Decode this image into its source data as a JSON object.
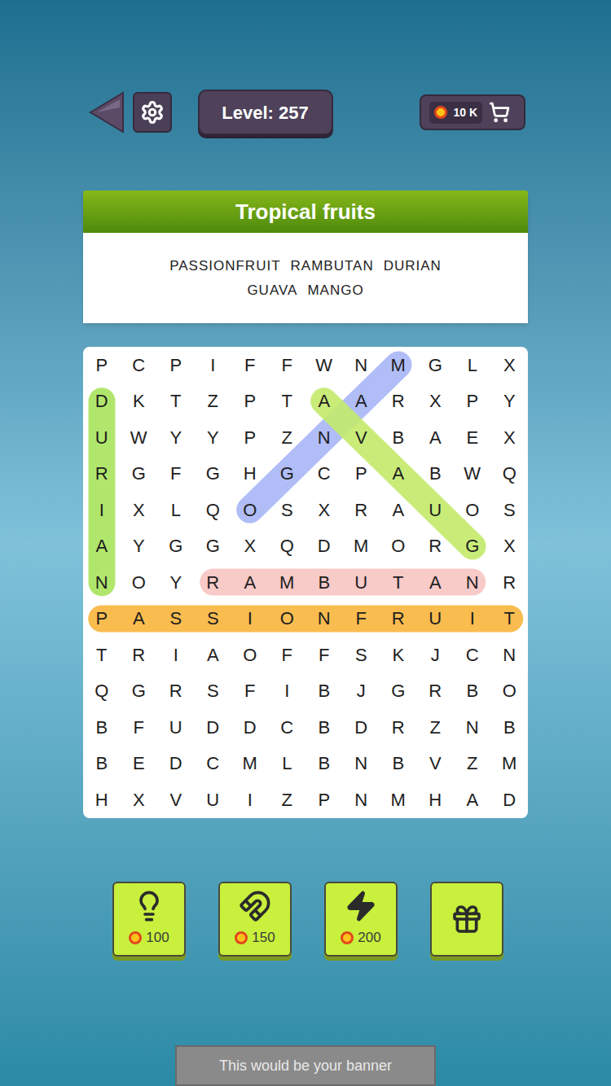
{
  "top_bar": {
    "level": "Level: 257",
    "coins": "10 K"
  },
  "category": {
    "title": "Tropical fruits",
    "words": [
      "PASSIONFRUIT",
      "RAMBUTAN",
      "DURIAN",
      "GUAVA",
      "MANGO"
    ]
  },
  "grid": {
    "rows": [
      [
        "P",
        "C",
        "P",
        "I",
        "F",
        "F",
        "W",
        "N",
        "M",
        "G",
        "L",
        "X"
      ],
      [
        "D",
        "K",
        "T",
        "Z",
        "P",
        "T",
        "A",
        "A",
        "R",
        "X",
        "P",
        "Y"
      ],
      [
        "U",
        "W",
        "Y",
        "Y",
        "P",
        "Z",
        "N",
        "V",
        "B",
        "A",
        "E",
        "X"
      ],
      [
        "R",
        "G",
        "F",
        "G",
        "H",
        "G",
        "C",
        "P",
        "A",
        "B",
        "W",
        "Q"
      ],
      [
        "I",
        "X",
        "L",
        "Q",
        "O",
        "S",
        "X",
        "R",
        "A",
        "U",
        "O",
        "S"
      ],
      [
        "A",
        "Y",
        "G",
        "G",
        "X",
        "Q",
        "D",
        "M",
        "O",
        "R",
        "G",
        "X"
      ],
      [
        "N",
        "O",
        "Y",
        "R",
        "A",
        "M",
        "B",
        "U",
        "T",
        "A",
        "N",
        "R"
      ],
      [
        "P",
        "A",
        "S",
        "S",
        "I",
        "O",
        "N",
        "F",
        "R",
        "U",
        "I",
        "T"
      ],
      [
        "T",
        "R",
        "I",
        "A",
        "O",
        "F",
        "F",
        "S",
        "K",
        "J",
        "C",
        "N"
      ],
      [
        "Q",
        "G",
        "R",
        "S",
        "F",
        "I",
        "B",
        "J",
        "G",
        "R",
        "B",
        "O"
      ],
      [
        "B",
        "F",
        "U",
        "D",
        "D",
        "C",
        "B",
        "D",
        "R",
        "Z",
        "N",
        "B"
      ],
      [
        "B",
        "E",
        "D",
        "C",
        "M",
        "L",
        "B",
        "N",
        "B",
        "V",
        "Z",
        "M"
      ],
      [
        "H",
        "X",
        "V",
        "U",
        "I",
        "Z",
        "P",
        "N",
        "M",
        "H",
        "A",
        "D"
      ]
    ],
    "highlights": [
      {
        "start": [
          1,
          0
        ],
        "end": [
          6,
          0
        ],
        "color": "#a9e35c"
      },
      {
        "start": [
          0,
          8
        ],
        "end": [
          4,
          4
        ],
        "color": "#a7b6f6"
      },
      {
        "start": [
          5,
          10
        ],
        "end": [
          1,
          6
        ],
        "color": "#c3ea6a"
      },
      {
        "start": [
          6,
          3
        ],
        "end": [
          6,
          10
        ],
        "color": "#f7c4c2"
      },
      {
        "start": [
          7,
          0
        ],
        "end": [
          7,
          11
        ],
        "color": "#f8b53c"
      }
    ]
  },
  "powerups": [
    {
      "kind": "hint",
      "price": "100"
    },
    {
      "kind": "magnet",
      "price": "150"
    },
    {
      "kind": "lightning",
      "price": "200"
    },
    {
      "kind": "video"
    }
  ],
  "banner": "This would be your banner"
}
